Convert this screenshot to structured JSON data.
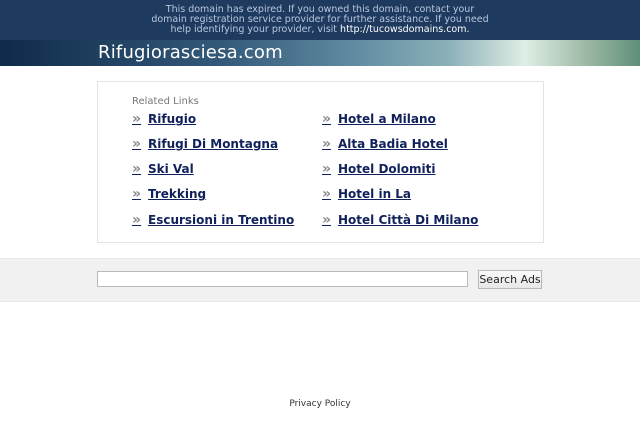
{
  "banner": {
    "message_line1": "This domain has expired. If you owned this domain, contact your domain registration service provider for further assistance. If you need help identifying your provider, visit",
    "domain_link": "http://tucowsdomains.com."
  },
  "site": {
    "title": "Rifugiorasciesa.com"
  },
  "related_links": {
    "label": "Related Links",
    "left": [
      "Rifugio",
      "Rifugi Di Montagna",
      "Ski Val",
      "Trekking",
      "Escursioni in Trentino"
    ],
    "right": [
      "Hotel a Milano",
      "Alta Badia Hotel",
      "Hotel Dolomiti",
      "Hotel in La",
      "Hotel Città Di Milano"
    ]
  },
  "search": {
    "placeholder": "",
    "button_label": "Search Ads"
  },
  "footer": {
    "privacy_label": "Privacy Policy"
  },
  "icons": {
    "bullet": "double-chevron-right-icon"
  }
}
